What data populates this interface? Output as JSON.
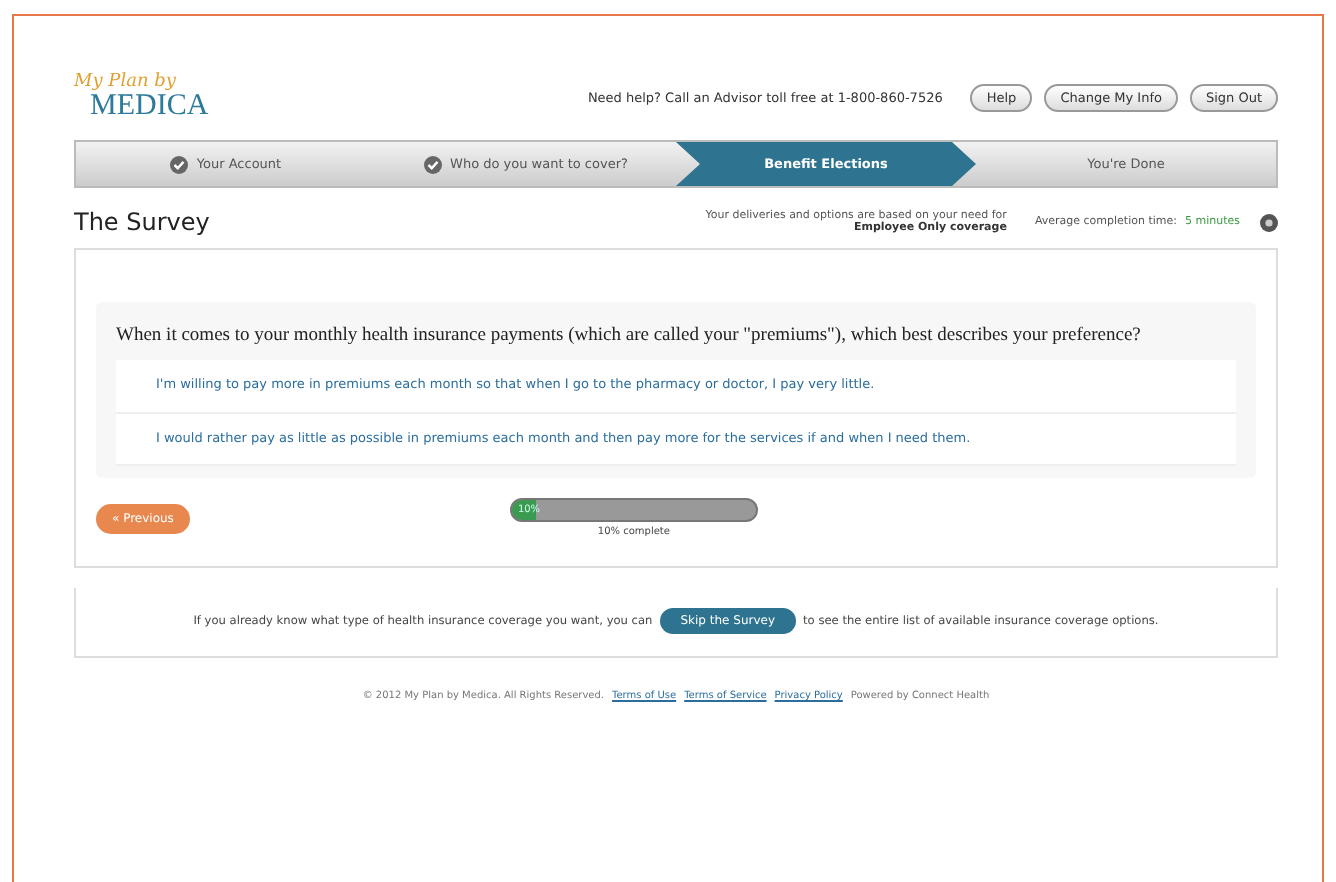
{
  "header": {
    "logo_script": "My Plan by",
    "logo": "MEDICA",
    "help_text": "Need help? Call an Advisor toll free at 1-800-860-7526",
    "buttons": [
      "Help",
      "Change My Info",
      "Sign Out"
    ]
  },
  "steps": [
    {
      "label": "Your Account",
      "completed": true,
      "selected": false
    },
    {
      "label": "Who do you want to cover?",
      "completed": true,
      "selected": false
    },
    {
      "label": "Benefit Elections",
      "completed": false,
      "selected": true
    },
    {
      "label": "You're Done",
      "completed": false,
      "selected": false
    }
  ],
  "page": {
    "title": "The Survey",
    "coverage_note": "Your deliveries and options are based on your need for",
    "coverage": "Employee Only coverage",
    "completion_label": "Average completion time:",
    "completion_time": "5 minutes"
  },
  "question": {
    "text": "When it comes to your monthly health insurance payments (which are called your \"premiums\"), which best describes your preference?",
    "options": [
      {
        "text": "I'm willing to pay more in premiums each month so that when I go to the pharmacy or doctor, I pay very little.",
        "selected": false
      },
      {
        "text": "I would rather pay as little as possible in premiums each month and then pay more for the services if and when I need them.",
        "selected": false
      }
    ]
  },
  "previous_button": "« Previous",
  "progress": {
    "level": 0.1,
    "label": "10%",
    "caption": "10% complete"
  },
  "skip": {
    "before": "If you already know what type of health insurance coverage you want, you can",
    "button": "Skip the Survey",
    "after": "to see the entire list of available insurance coverage options."
  },
  "footer": {
    "copyright": "© 2012 My Plan by Medica. All Rights Reserved.",
    "links": [
      "Terms of Use",
      "Terms of Service",
      "Privacy Policy"
    ],
    "powered": "Powered by Connect Health"
  }
}
